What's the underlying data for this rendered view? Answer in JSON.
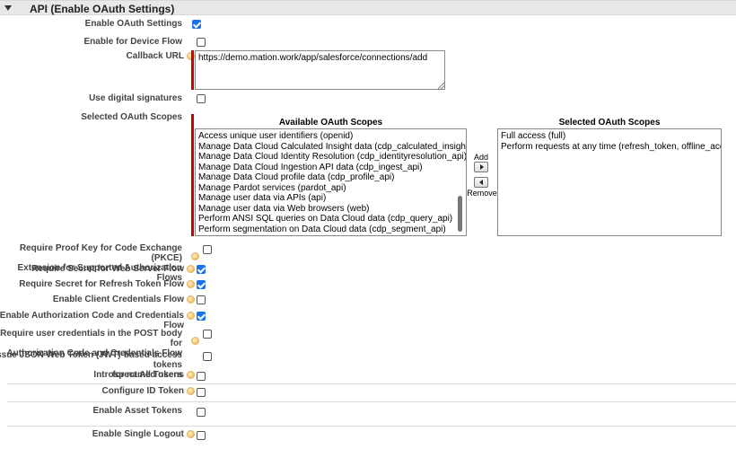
{
  "section": {
    "title": "API (Enable OAuth Settings)"
  },
  "fields": {
    "enable_oauth": {
      "label": "Enable OAuth Settings",
      "checked": true
    },
    "device_flow": {
      "label": "Enable for Device Flow",
      "checked": false
    },
    "callback_url": {
      "label": "Callback URL",
      "value": "https://demo.mation.work/app/salesforce/connections/add"
    },
    "digital_signatures": {
      "label": "Use digital signatures",
      "checked": false
    },
    "oauth_scopes": {
      "label": "Selected OAuth Scopes"
    },
    "pkce": {
      "label_line1": "Require Proof Key for Code Exchange (PKCE)",
      "label_line2": "Extension for Supported Authorization Flows",
      "checked": false
    },
    "secret_web_server": {
      "label": "Require Secret for Web Server Flow",
      "checked": true
    },
    "secret_refresh": {
      "label": "Require Secret for Refresh Token Flow",
      "checked": true
    },
    "client_credentials": {
      "label": "Enable Client Credentials Flow",
      "checked": false
    },
    "auth_code_credentials": {
      "label": "Enable Authorization Code and Credentials Flow",
      "checked": true
    },
    "post_body_credentials": {
      "label_line1": "Require user credentials in the POST body for",
      "label_line2": "Authorization Code and Credentials Flow",
      "checked": false
    },
    "jwt_tokens": {
      "label_line1": "Issue JSON Web Token (JWT)-based access tokens",
      "label_line2": "for named users",
      "checked": false
    },
    "introspect": {
      "label": "Introspect All Tokens",
      "checked": false
    },
    "id_token": {
      "label": "Configure ID Token",
      "checked": false
    },
    "asset_tokens": {
      "label": "Enable Asset Tokens",
      "checked": false
    },
    "single_logout": {
      "label": "Enable Single Logout",
      "checked": false
    }
  },
  "scopes": {
    "available_header": "Available OAuth Scopes",
    "selected_header": "Selected OAuth Scopes",
    "add_label": "Add",
    "remove_label": "Remove",
    "available": [
      "Access unique user identifiers (openid)",
      "Manage Data Cloud Calculated Insight data (cdp_calculated_insight_api)",
      "Manage Data Cloud Identity Resolution (cdp_identityresolution_api)",
      "Manage Data Cloud Ingestion API data (cdp_ingest_api)",
      "Manage Data Cloud profile data (cdp_profile_api)",
      "Manage Pardot services (pardot_api)",
      "Manage user data via APIs (api)",
      "Manage user data via Web browsers (web)",
      "Perform ANSI SQL queries on Data Cloud data (cdp_query_api)",
      "Perform segmentation on Data Cloud data (cdp_segment_api)"
    ],
    "selected": [
      "Full access (full)",
      "Perform requests at any time (refresh_token, offline_access)"
    ]
  },
  "colors": {
    "required_bar": "#cc0000",
    "checkbox_on": "#1a73e8",
    "header_bg": "#e8e8e9"
  }
}
